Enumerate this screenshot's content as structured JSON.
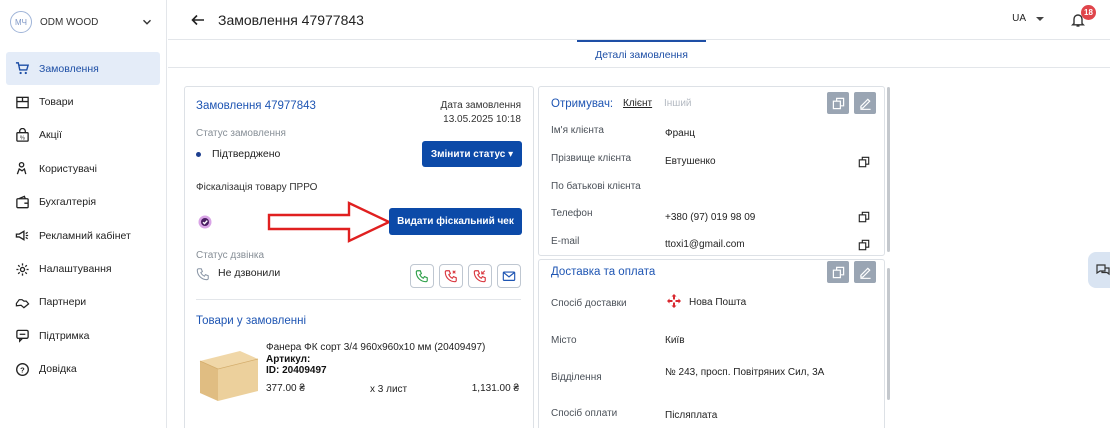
{
  "org": {
    "avatar_initials": "МЧ",
    "name": "ODM WOOD"
  },
  "sidebar": {
    "items": [
      {
        "label": "Замовлення",
        "icon": "cart-icon",
        "active": true
      },
      {
        "label": "Товари",
        "icon": "products-icon"
      },
      {
        "label": "Акції",
        "icon": "promo-icon"
      },
      {
        "label": "Користувачі",
        "icon": "users-icon"
      },
      {
        "label": "Бухгалтерія",
        "icon": "wallet-icon"
      },
      {
        "label": "Рекламний кабінет",
        "icon": "megaphone-icon"
      },
      {
        "label": "Налаштування",
        "icon": "gear-icon"
      },
      {
        "label": "Партнери",
        "icon": "handshake-icon"
      },
      {
        "label": "Підтримка",
        "icon": "chat-icon"
      },
      {
        "label": "Довідка",
        "icon": "help-icon"
      }
    ]
  },
  "header": {
    "title": "Замовлення 47977843",
    "language": "UA",
    "notifications_count": "18"
  },
  "tabs": {
    "active": "Деталі замовлення"
  },
  "order": {
    "title": "Замовлення 47977843",
    "date_label": "Дата замовлення",
    "date_value": "13.05.2025 10:18",
    "status_label": "Статус замовлення",
    "status_value": "Підтверджено",
    "change_status_button": "Змінити статус ▾",
    "fiscal_label": "Фіскалізація товару ПРРО",
    "fiscal_button": "Видати фіскальний чек",
    "call_status_label": "Статус дзвінка",
    "call_status_value": "Не дзвонили",
    "products_title": "Товари у замовленні",
    "product": {
      "name": "Фанера ФК сорт 3/4 960х960х10 мм (20409497)",
      "article_label": "Артикул:",
      "id": "ID: 20409497",
      "price": "377.00 ₴",
      "qty": "x 3 лист",
      "total": "1,131.00 ₴"
    }
  },
  "recipient": {
    "label": "Отримувач:",
    "tab_client": "Клієнт",
    "tab_other": "Інший",
    "fields": [
      {
        "label": "Ім'я клієнта",
        "value": "Франц"
      },
      {
        "label": "Прізвище клієнта",
        "value": "Евтушенко"
      },
      {
        "label": "По батькові клієнта",
        "value": ""
      },
      {
        "label": "Телефон",
        "value": "+380 (97) 019 98 09"
      },
      {
        "label": "E-mail",
        "value": "ttoxi1@gmail.com"
      }
    ]
  },
  "delivery": {
    "title": "Доставка та оплата",
    "fields": [
      {
        "label": "Спосіб доставки",
        "value": "Нова Пошта"
      },
      {
        "label": "Місто",
        "value": "Київ"
      },
      {
        "label": "Відділення",
        "value": "№ 243, просп. Повітряних Сил, 3А"
      },
      {
        "label": "Спосіб оплати",
        "value": "Післяплата"
      }
    ]
  },
  "colors": {
    "primary": "#0c4aa8",
    "accent_blue": "#1e55b3",
    "arrow_red": "#e02020",
    "badge_red": "#e0454b"
  }
}
